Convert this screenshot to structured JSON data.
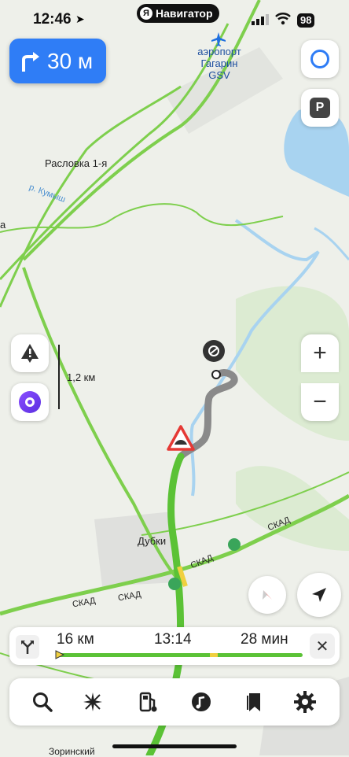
{
  "status": {
    "time": "12:46",
    "app_pill": "Навигатор",
    "ya_letter": "Я",
    "battery": "98"
  },
  "maneuver": {
    "distance": "30 м"
  },
  "map": {
    "airport_label_1": "аэропорт",
    "airport_label_2": "Гагарин",
    "airport_label_3": "GSV",
    "village_1": "Расловка 1-я",
    "river": "р. Кумыш",
    "village_2": "Дубки",
    "road_1": "СКАД",
    "road_2": "СКАД",
    "road_3": "СКАД",
    "road_4": "СКАД",
    "bottom_label": "Зоринский",
    "left_edge": "а"
  },
  "scale": {
    "label": "1,2 км"
  },
  "parking_button": {
    "label": "P"
  },
  "zoom": {
    "plus": "+",
    "minus": "−"
  },
  "route": {
    "distance": "16 км",
    "arrival": "13:14",
    "duration": "28 мин",
    "progress": 0.02
  },
  "close_label": "✕",
  "colors": {
    "accent": "#2f7df6",
    "route": "#5bc236",
    "route_done": "#8a8a8a",
    "hazard": "#e53935"
  }
}
